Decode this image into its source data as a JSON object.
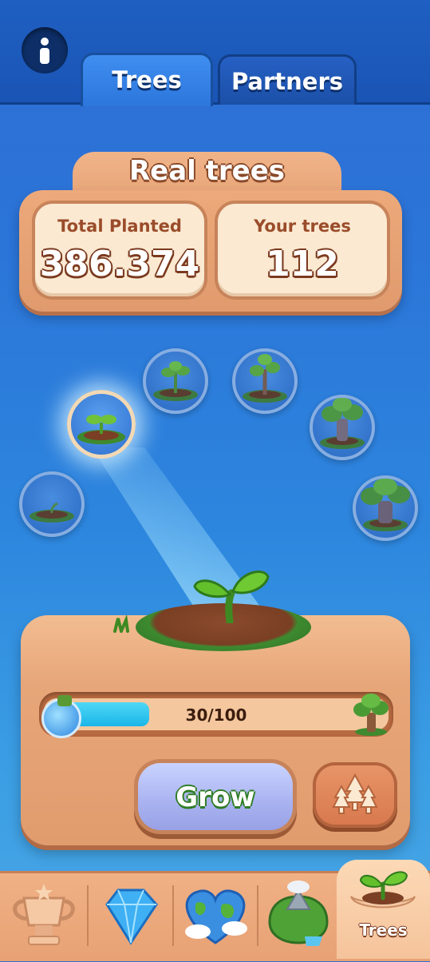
{
  "tabs": [
    {
      "label": "Trees",
      "active": true
    },
    {
      "label": "Partners",
      "active": false
    }
  ],
  "real_trees": {
    "title": "Real trees",
    "total_planted_label": "Total Planted",
    "total_planted_value": "386.374",
    "your_trees_label": "Your trees",
    "your_trees_value": "112"
  },
  "growth_stages": {
    "count": 6,
    "current_stage": 2
  },
  "progress": {
    "current": 30,
    "max": 100,
    "text": "30/100"
  },
  "buttons": {
    "grow_label": "Grow"
  },
  "bottom_nav": {
    "items": [
      {
        "icon": "trophy-icon"
      },
      {
        "icon": "gem-icon"
      },
      {
        "icon": "globe-heart-icon"
      },
      {
        "icon": "island-icon"
      },
      {
        "icon": "sprout-hands-icon",
        "label": "Trees",
        "active": true
      }
    ]
  },
  "colors": {
    "accent_blue": "#2c76dc",
    "panel_orange": "#e7a679",
    "progress_fill": "#1ab6e8",
    "grow_text_outline": "#2e7d25"
  }
}
